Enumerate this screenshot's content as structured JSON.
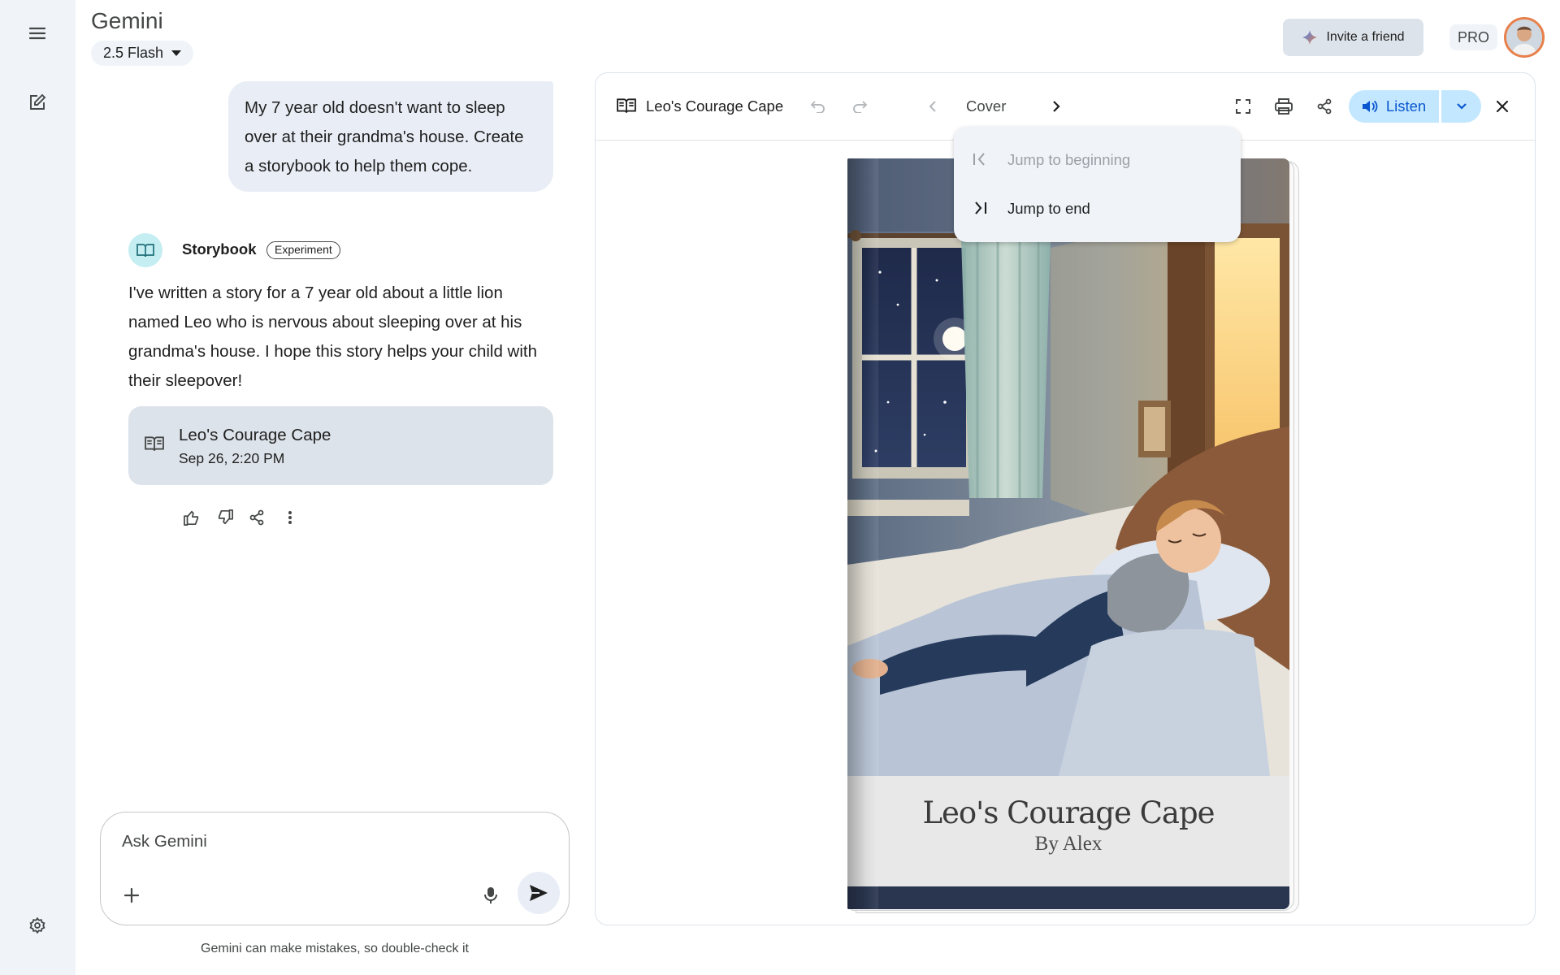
{
  "app": {
    "title": "Gemini",
    "model_label": "2.5 Flash"
  },
  "header": {
    "invite_label": "Invite a friend",
    "pro_label": "PRO"
  },
  "conversation": {
    "user_message": "My 7 year old doesn't want to sleep over at their grandma's house. Create a storybook to help them cope.",
    "agent_name": "Storybook",
    "agent_badge": "Experiment",
    "response_text": "I've written a story for a 7 year old about a little lion named Leo who is nervous about sleeping over at his grandma's house. I hope this story helps your child with their sleepover!",
    "story_card": {
      "title": "Leo's Courage Cape",
      "date": "Sep 26, 2:20 PM"
    }
  },
  "composer": {
    "placeholder": "Ask Gemini",
    "disclaimer": "Gemini can make mistakes, so double-check it"
  },
  "canvas": {
    "title": "Leo's Courage Cape",
    "page_label": "Cover",
    "listen_label": "Listen",
    "menu": [
      {
        "label": "Jump to beginning",
        "enabled": false
      },
      {
        "label": "Jump to end",
        "enabled": true
      }
    ],
    "book": {
      "title": "Leo's Courage Cape",
      "author": "By Alex"
    }
  },
  "colors": {
    "accent": "#0b57d0",
    "listen_bg": "#c2e7ff",
    "sidebar_bg": "#f0f4f9",
    "card_bg": "#dde3ea",
    "bubble_bg": "#e9eef6"
  },
  "icons": [
    "menu-icon",
    "new-chat-icon",
    "settings-icon",
    "sparkle-icon",
    "book-icon",
    "thumb-up-icon",
    "thumb-down-icon",
    "share-icon",
    "more-vert-icon",
    "plus-icon",
    "mic-icon",
    "send-icon",
    "undo-icon",
    "redo-icon",
    "chevron-left-icon",
    "chevron-right-icon",
    "fullscreen-icon",
    "print-icon",
    "volume-icon",
    "chevron-down-icon",
    "close-icon",
    "first-page-icon",
    "last-page-icon"
  ]
}
